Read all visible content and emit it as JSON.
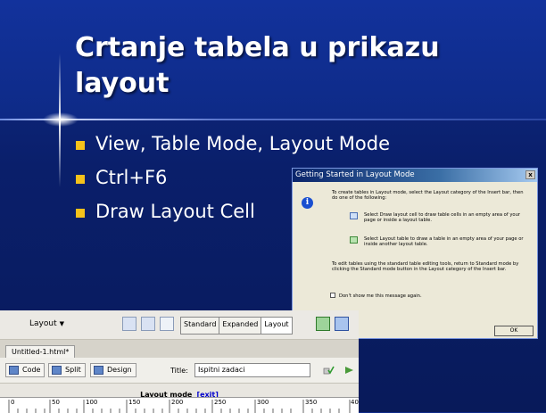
{
  "slide": {
    "title": "Crtanje tabela u prikazu layout",
    "bullets": [
      "View, Table Mode, Layout Mode",
      "Ctrl+F6",
      "Draw Layout Cell"
    ]
  },
  "dialog": {
    "title": "Getting Started in Layout Mode",
    "close": "x",
    "intro": "To create tables in Layout mode, select the Layout category of the Insert bar, then do one of the following:",
    "option1": "Select Draw layout cell to draw table cells in an empty area of your page or inside a layout table.",
    "option2": "Select Layout table to draw a table in an empty area of your page or inside another layout table.",
    "outro": "To edit tables using the standard table editing tools, return to Standard mode by clicking the Standard mode button in the Layout category of the Insert bar.",
    "checkbox_label": "Don't show me this message again.",
    "ok_label": "OK"
  },
  "editor": {
    "insert_category": "Layout",
    "modes": [
      "Standard",
      "Expanded",
      "Layout"
    ],
    "active_mode": "Layout",
    "document_tab": "Untitled-1.html*",
    "view_buttons": [
      "Code",
      "Split",
      "Design"
    ],
    "title_label": "Title:",
    "title_value": "Ispitni zadaci",
    "layout_mode_label": "Layout mode",
    "exit_label": "[exit]",
    "ruler_marks": [
      "0",
      "50",
      "100",
      "150",
      "200",
      "250",
      "300",
      "350",
      "40"
    ]
  },
  "colors": {
    "background": "#0a1f6b",
    "bullet": "#f5c21b",
    "dialog_title": "#0a246a"
  }
}
